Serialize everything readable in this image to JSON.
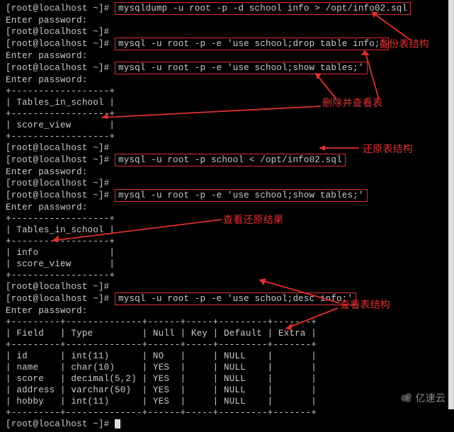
{
  "prompt": "[root@localhost ~]#",
  "enter_pwd": "Enter password:",
  "cmds": {
    "dump": "mysqldump -u root -p -d school info > /opt/info02.sql",
    "drop": "mysql -u root -p -e 'use school;drop table info;'",
    "show1": "mysql -u root -p -e 'use school;show tables;'",
    "restore": "mysql -u root -p school < /opt/info02.sql",
    "show2": "mysql -u root -p -e 'use school;show tables;'",
    "desc": "mysql -u root -p -e 'use school;desc info;'"
  },
  "table_sep_short": "+------------------+",
  "tables_header": "| Tables_in_school |",
  "tables_rows1": [
    "| score_view       |"
  ],
  "tables_rows2": [
    "| info             |",
    "| score_view       |"
  ],
  "desc_sep": "+---------+--------------+------+-----+---------+-------+",
  "desc_header": "| Field   | Type         | Null | Key | Default | Extra |",
  "desc_rows": [
    "| id      | int(11)      | NO   |     | NULL    |       |",
    "| name    | char(10)     | YES  |     | NULL    |       |",
    "| score   | decimal(5,2) | YES  |     | NULL    |       |",
    "| address | varchar(50)  | YES  |     | NULL    |       |",
    "| hobby   | int(11)      | YES  |     | NULL    |       |"
  ],
  "annotations": {
    "backup": "备份表结构",
    "del_show": "删除并查看表",
    "restore_tbl": "还原表结构",
    "view_restore": "查看还原结果",
    "view_struct": "查看表结构"
  },
  "watermark": "亿速云",
  "chart_data": {
    "type": "table",
    "title": "desc info",
    "columns": [
      "Field",
      "Type",
      "Null",
      "Key",
      "Default",
      "Extra"
    ],
    "rows": [
      [
        "id",
        "int(11)",
        "NO",
        "",
        "NULL",
        ""
      ],
      [
        "name",
        "char(10)",
        "YES",
        "",
        "NULL",
        ""
      ],
      [
        "score",
        "decimal(5,2)",
        "YES",
        "",
        "NULL",
        ""
      ],
      [
        "address",
        "varchar(50)",
        "YES",
        "",
        "NULL",
        ""
      ],
      [
        "hobby",
        "int(11)",
        "YES",
        "",
        "NULL",
        ""
      ]
    ]
  }
}
